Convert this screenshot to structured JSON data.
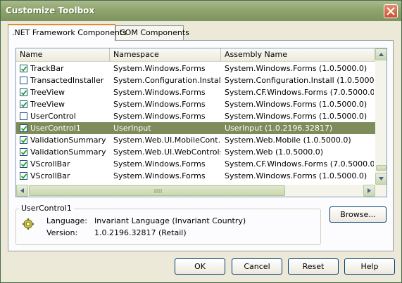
{
  "window": {
    "title": "Customize Toolbox"
  },
  "tabs": [
    {
      "label": ".NET Framework Components",
      "active": true
    },
    {
      "label": "COM Components",
      "active": false
    }
  ],
  "columns": [
    "Name",
    "Namespace",
    "Assembly Name"
  ],
  "rows": [
    {
      "checked": true,
      "name": "TrackBar",
      "namespace": "System.Windows.Forms",
      "assembly": "System.Windows.Forms (1.0.5000.0)"
    },
    {
      "checked": false,
      "name": "TransactedInstaller",
      "namespace": "System.Configuration.Install",
      "assembly": "System.Configuration.Install (1.0.5000..."
    },
    {
      "checked": true,
      "name": "TreeView",
      "namespace": "System.Windows.Forms",
      "assembly": "System.CF.Windows.Forms (7.0.5000.0)"
    },
    {
      "checked": true,
      "name": "TreeView",
      "namespace": "System.Windows.Forms",
      "assembly": "System.Windows.Forms (1.0.5000.0)"
    },
    {
      "checked": false,
      "name": "UserControl",
      "namespace": "System.Windows.Forms",
      "assembly": "System.Windows.Forms (1.0.5000.0)"
    },
    {
      "checked": true,
      "name": "UserControl1",
      "namespace": "UserInput",
      "assembly": "UserInput (1.0.2196.32817)",
      "selected": true
    },
    {
      "checked": true,
      "name": "ValidationSummary",
      "namespace": "System.Web.UI.MobileCont...",
      "assembly": "System.Web.Mobile (1.0.5000.0)"
    },
    {
      "checked": true,
      "name": "ValidationSummary",
      "namespace": "System.Web.UI.WebControls",
      "assembly": "System.Web (1.0.5000.0)"
    },
    {
      "checked": true,
      "name": "VScrollBar",
      "namespace": "System.Windows.Forms",
      "assembly": "System.CF.Windows.Forms (7.0.5000.0)"
    },
    {
      "checked": true,
      "name": "VScrollBar",
      "namespace": "System.Windows.Forms",
      "assembly": "System.Windows.Forms (1.0.5000.0)"
    }
  ],
  "details": {
    "title": "UserControl1",
    "language_label": "Language:",
    "language_value": "Invariant Language (Invariant Country)",
    "version_label": "Version:",
    "version_value": "1.0.2196.32817 (Retail)"
  },
  "buttons": {
    "browse": "Browse...",
    "ok": "OK",
    "cancel": "Cancel",
    "reset": "Reset",
    "help": "Help"
  },
  "colors": {
    "selection": "#7e8c5b",
    "titlebar": "#8fa56c",
    "tab_accent": "#e68b2c"
  }
}
